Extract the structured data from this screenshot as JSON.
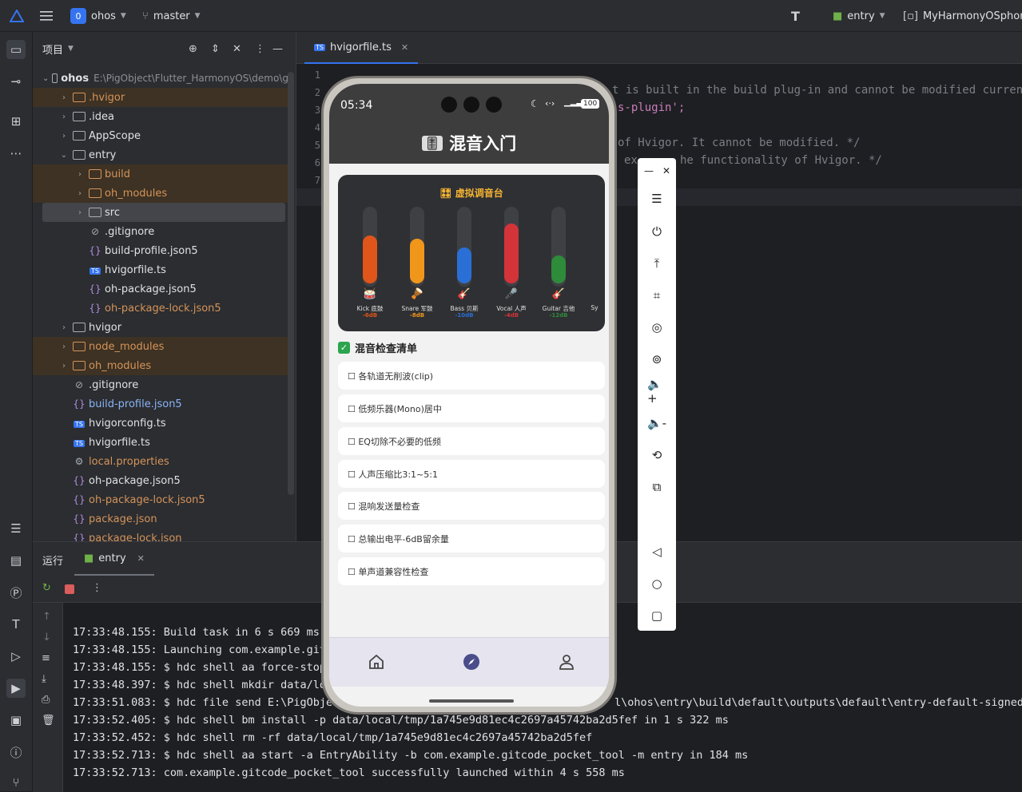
{
  "titlebar": {
    "project_badge": "0",
    "project_name": "ohos",
    "branch": "master",
    "run_config": "entry",
    "device": "MyHarmonyOSphone"
  },
  "project_panel": {
    "title": "项目",
    "tree": [
      {
        "label": "ohos",
        "extra": "E:\\PigObject\\Flutter_HarmonyOS\\demo\\g",
        "type": "root"
      },
      {
        "label": ".hvigor",
        "type": "folder-excluded"
      },
      {
        "label": ".idea",
        "type": "folder"
      },
      {
        "label": "AppScope",
        "type": "folder"
      },
      {
        "label": "entry",
        "type": "folder-open"
      },
      {
        "label": "build",
        "type": "folder-excluded"
      },
      {
        "label": "oh_modules",
        "type": "folder-excluded"
      },
      {
        "label": "src",
        "type": "folder-selected"
      },
      {
        "label": ".gitignore",
        "type": "file"
      },
      {
        "label": "build-profile.json5",
        "type": "json"
      },
      {
        "label": "hvigorfile.ts",
        "type": "ts"
      },
      {
        "label": "oh-package.json5",
        "type": "json"
      },
      {
        "label": "oh-package-lock.json5",
        "type": "json-orange"
      },
      {
        "label": "hvigor",
        "type": "folder"
      },
      {
        "label": "node_modules",
        "type": "folder-excluded"
      },
      {
        "label": "oh_modules",
        "type": "folder-excluded"
      },
      {
        "label": ".gitignore",
        "type": "file"
      },
      {
        "label": "build-profile.json5",
        "type": "json-blue"
      },
      {
        "label": "hvigorconfig.ts",
        "type": "ts"
      },
      {
        "label": "hvigorfile.ts",
        "type": "ts"
      },
      {
        "label": "local.properties",
        "type": "props"
      },
      {
        "label": "oh-package.json5",
        "type": "json"
      },
      {
        "label": "oh-package-lock.json5",
        "type": "json-orange"
      },
      {
        "label": "package.json",
        "type": "json-orange"
      },
      {
        "label": "package-lock.json",
        "type": "json-orange"
      }
    ]
  },
  "editor": {
    "tab": "hvigorfile.ts",
    "lines": [
      "1",
      "2",
      "3",
      "4",
      "5",
      "6",
      "7",
      "8"
    ],
    "code_fragments": [
      "t is built in the build plug-in and cannot be modified currently",
      "s-plugin';",
      "of Hvigor. It cannot be modified. */",
      "ex",
      "he functionality of Hvigor. */"
    ]
  },
  "run_panel": {
    "title": "运行",
    "tab": "entry",
    "log": [
      "17:33:48.155: Build task in 6 s 669 ms",
      "17:33:48.155: Launching com.example.git",
      "17:33:48.155: $ hdc shell aa force-stop",
      "17:33:48.397: $ hdc shell mkdir data/lo",
      "17:33:51.083: $ hdc file send E:\\PigObje",
      "17:33:52.405: $ hdc shell bm install -p data/local/tmp/1a745e9d81ec4c2697a45742ba2d5fef in 1 s 322 ms",
      "17:33:52.452: $ hdc shell rm -rf data/local/tmp/1a745e9d81ec4c2697a45742ba2d5fef",
      "17:33:52.713: $ hdc shell aa start -a EntryAbility -b com.example.gitcode_pocket_tool -m entry in 184 ms",
      "17:33:52.713: com.example.gitcode_pocket_tool successfully launched within 4 s 558 ms"
    ],
    "log_right_fragment": "l\\ohos\\entry\\build\\default\\outputs\\default\\entry-default-signed.h"
  },
  "phone": {
    "time": "05:34",
    "battery": "100",
    "app_title": "混音入门",
    "mixer_title": "虚拟调音台",
    "channels": [
      {
        "name": "Kick 底鼓",
        "db": "-6dB",
        "level": 0.6,
        "color": "#e0551a",
        "db_color": "#e0551a",
        "icon": "🥁"
      },
      {
        "name": "Snare 军鼓",
        "db": "-8dB",
        "level": 0.56,
        "color": "#f0961a",
        "db_color": "#f0961a",
        "icon": "🪘"
      },
      {
        "name": "Bass 贝斯",
        "db": "-10dB",
        "level": 0.45,
        "color": "#2a6fd6",
        "db_color": "#2a6fd6",
        "icon": "🎸"
      },
      {
        "name": "Vocal 人声",
        "db": "-4dB",
        "level": 0.75,
        "color": "#d2343a",
        "db_color": "#d2343a",
        "icon": "🎤"
      },
      {
        "name": "Guitar 吉他",
        "db": "-12dB",
        "level": 0.35,
        "color": "#2e8b3a",
        "db_color": "#2e8b3a",
        "icon": "🎸"
      },
      {
        "name": "Sy",
        "db": "",
        "level": 0,
        "color": "#888888",
        "db_color": "#888888",
        "icon": ""
      }
    ],
    "checklist_title": "混音检查清单",
    "checklist": [
      "☐ 各轨道无削波(clip)",
      "☐ 低频乐器(Mono)居中",
      "☐ EQ切除不必要的低频",
      "☐ 人声压缩比3:1~5:1",
      "☐ 混响发送量检查",
      "☐ 总输出电平-6dB留余量",
      "☐ 单声道兼容性检查"
    ]
  }
}
